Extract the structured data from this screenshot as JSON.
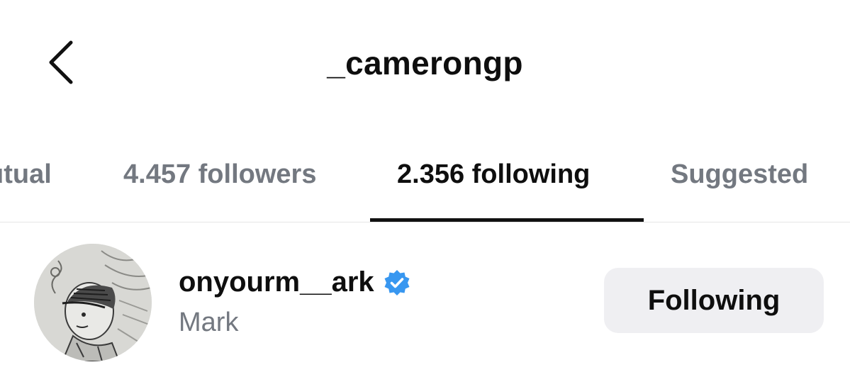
{
  "header": {
    "back_icon": "chevron-left-icon",
    "title": "_camerongp"
  },
  "tabs": [
    {
      "label": "utual",
      "active": false
    },
    {
      "label": "4.457 followers",
      "active": false
    },
    {
      "label": "2.356 following",
      "active": true
    },
    {
      "label": "Suggested",
      "active": false
    }
  ],
  "list": [
    {
      "username": "onyourm__ark",
      "verified": true,
      "verified_icon": "verified-badge-icon",
      "full_name": "Mark",
      "button_label": "Following"
    }
  ],
  "colors": {
    "text_primary": "#0e0e0e",
    "text_secondary": "#737880",
    "verified_blue": "#3897f0",
    "button_bg": "#efeff2",
    "divider": "#e6e6e6"
  }
}
